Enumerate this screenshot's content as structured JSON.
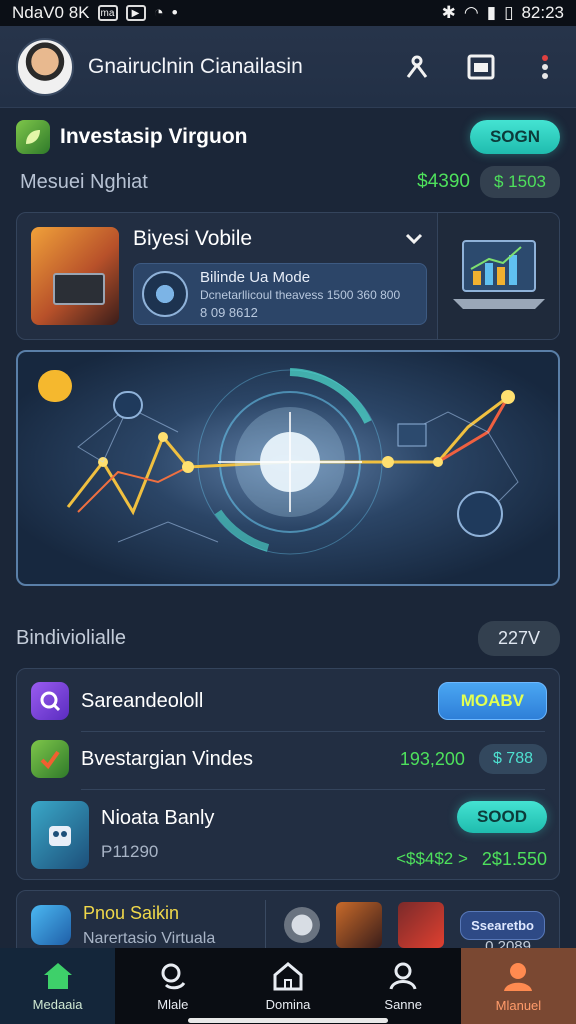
{
  "status_bar": {
    "left_text": "NdaV0 8K",
    "box_icon_label": "ma",
    "time": "82:23"
  },
  "header": {
    "title": "Gnairuclnin Cianailasin"
  },
  "section": {
    "title": "Investasip Virguon",
    "button_label": "SOGN"
  },
  "summary": {
    "label": "Mesuei Nghiat",
    "value": "$4390",
    "change": "$ 1503"
  },
  "feature_card": {
    "title": "Biyesi Vobile",
    "inner_title": "Bilinde Ua Mode",
    "inner_subtitle": "Dcnetarllicoul theavess 1500 360 800",
    "inner_value": "8 09 8612"
  },
  "list_section": {
    "title": "Bindiviolialle",
    "badge": "227V"
  },
  "list": [
    {
      "title": "Sareandeololl",
      "button_label": "MOABV"
    },
    {
      "title": "Bvestargian Vindes",
      "value": "193,200",
      "pill": "$ 788"
    },
    {
      "title": "Nioata Banly",
      "subvalue": "P11290",
      "button_label": "SOOD",
      "value": "<$$4$2 >",
      "pill": "2$1.550"
    }
  ],
  "promo": {
    "title": "Pnou Saikin",
    "subtitle": "Narertasio Virtuala",
    "button_label": "Ssearetbo",
    "value": "0 2089"
  },
  "nav": [
    {
      "label": "Medaaia"
    },
    {
      "label": "Mlale"
    },
    {
      "label": "Domina"
    },
    {
      "label": "Sanne"
    },
    {
      "label": "Mlanuel"
    }
  ],
  "colors": {
    "accent_teal": "#2fd3c2",
    "accent_green": "#4ee05c",
    "accent_blue": "#3a8fe6",
    "background": "#1b2638"
  }
}
